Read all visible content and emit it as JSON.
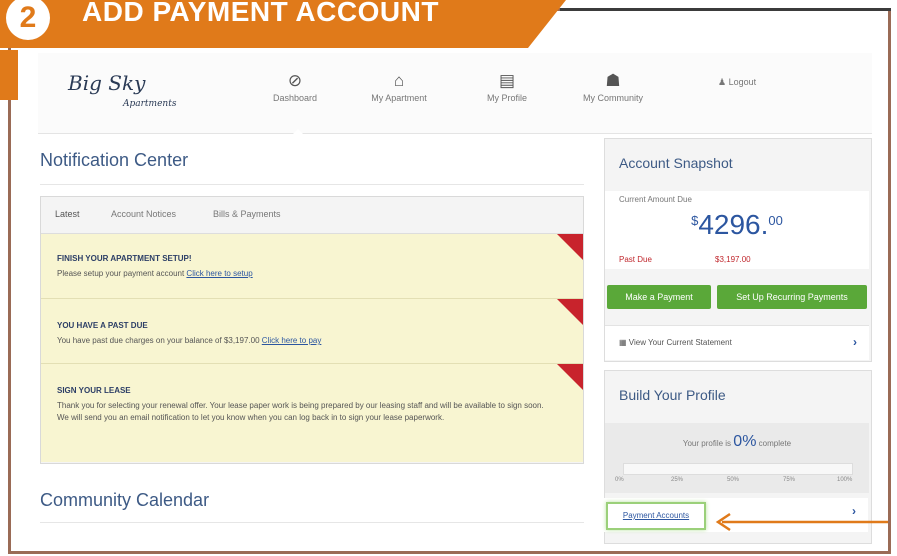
{
  "step": {
    "number": "2",
    "title": "ADD PAYMENT ACCOUNT"
  },
  "colors": {
    "banner": "#e07a1a",
    "accent_green": "#5aa839",
    "alert_red": "#c0272d",
    "link_blue": "#2c56a0"
  },
  "logo": {
    "text": "Big Sky",
    "subtext": "Apartments"
  },
  "nav": [
    {
      "label": "Dashboard",
      "icon": "dashboard-icon"
    },
    {
      "label": "My Apartment",
      "icon": "home-icon"
    },
    {
      "label": "My Profile",
      "icon": "profile-card-icon"
    },
    {
      "label": "My Community",
      "icon": "community-icon"
    }
  ],
  "logout": {
    "label": "Logout",
    "icon": "users-icon"
  },
  "notification_center": {
    "title": "Notification Center",
    "tabs": [
      "Latest",
      "Account Notices",
      "Bills & Payments"
    ],
    "items": [
      {
        "title": "FINISH YOUR APARTMENT SETUP!",
        "body": "Please setup your payment account",
        "link": "Click here to setup"
      },
      {
        "title": "YOU HAVE A PAST DUE",
        "body": "You have past due charges on your balance of $3,197.00",
        "link": "Click here to pay"
      },
      {
        "title": "SIGN YOUR LEASE",
        "body": "Thank you for selecting your renewal offer. Your lease paper work is being prepared by our leasing staff and will be available to sign soon. We will send you an email notification to let you know when you can log back in to sign your lease paperwork.",
        "link": ""
      }
    ]
  },
  "community_calendar": {
    "title": "Community Calendar"
  },
  "account_snapshot": {
    "title": "Account Snapshot",
    "current_label": "Current Amount Due",
    "amount_symbol": "$",
    "amount_whole": "4296.",
    "amount_cents": "00",
    "past_due_label": "Past Due",
    "past_due_value": "$3,197.00",
    "make_payment": "Make a Payment",
    "recurring": "Set Up Recurring Payments",
    "statement": "View Your Current Statement"
  },
  "build_profile": {
    "title": "Build Your Profile",
    "pct_prefix": "Your profile is",
    "pct_value": "0%",
    "pct_suffix": "complete",
    "progress": 0,
    "ticks": [
      "0%",
      "25%",
      "50%",
      "75%",
      "100%"
    ]
  },
  "payment_accounts": {
    "label": "Payment Accounts"
  }
}
